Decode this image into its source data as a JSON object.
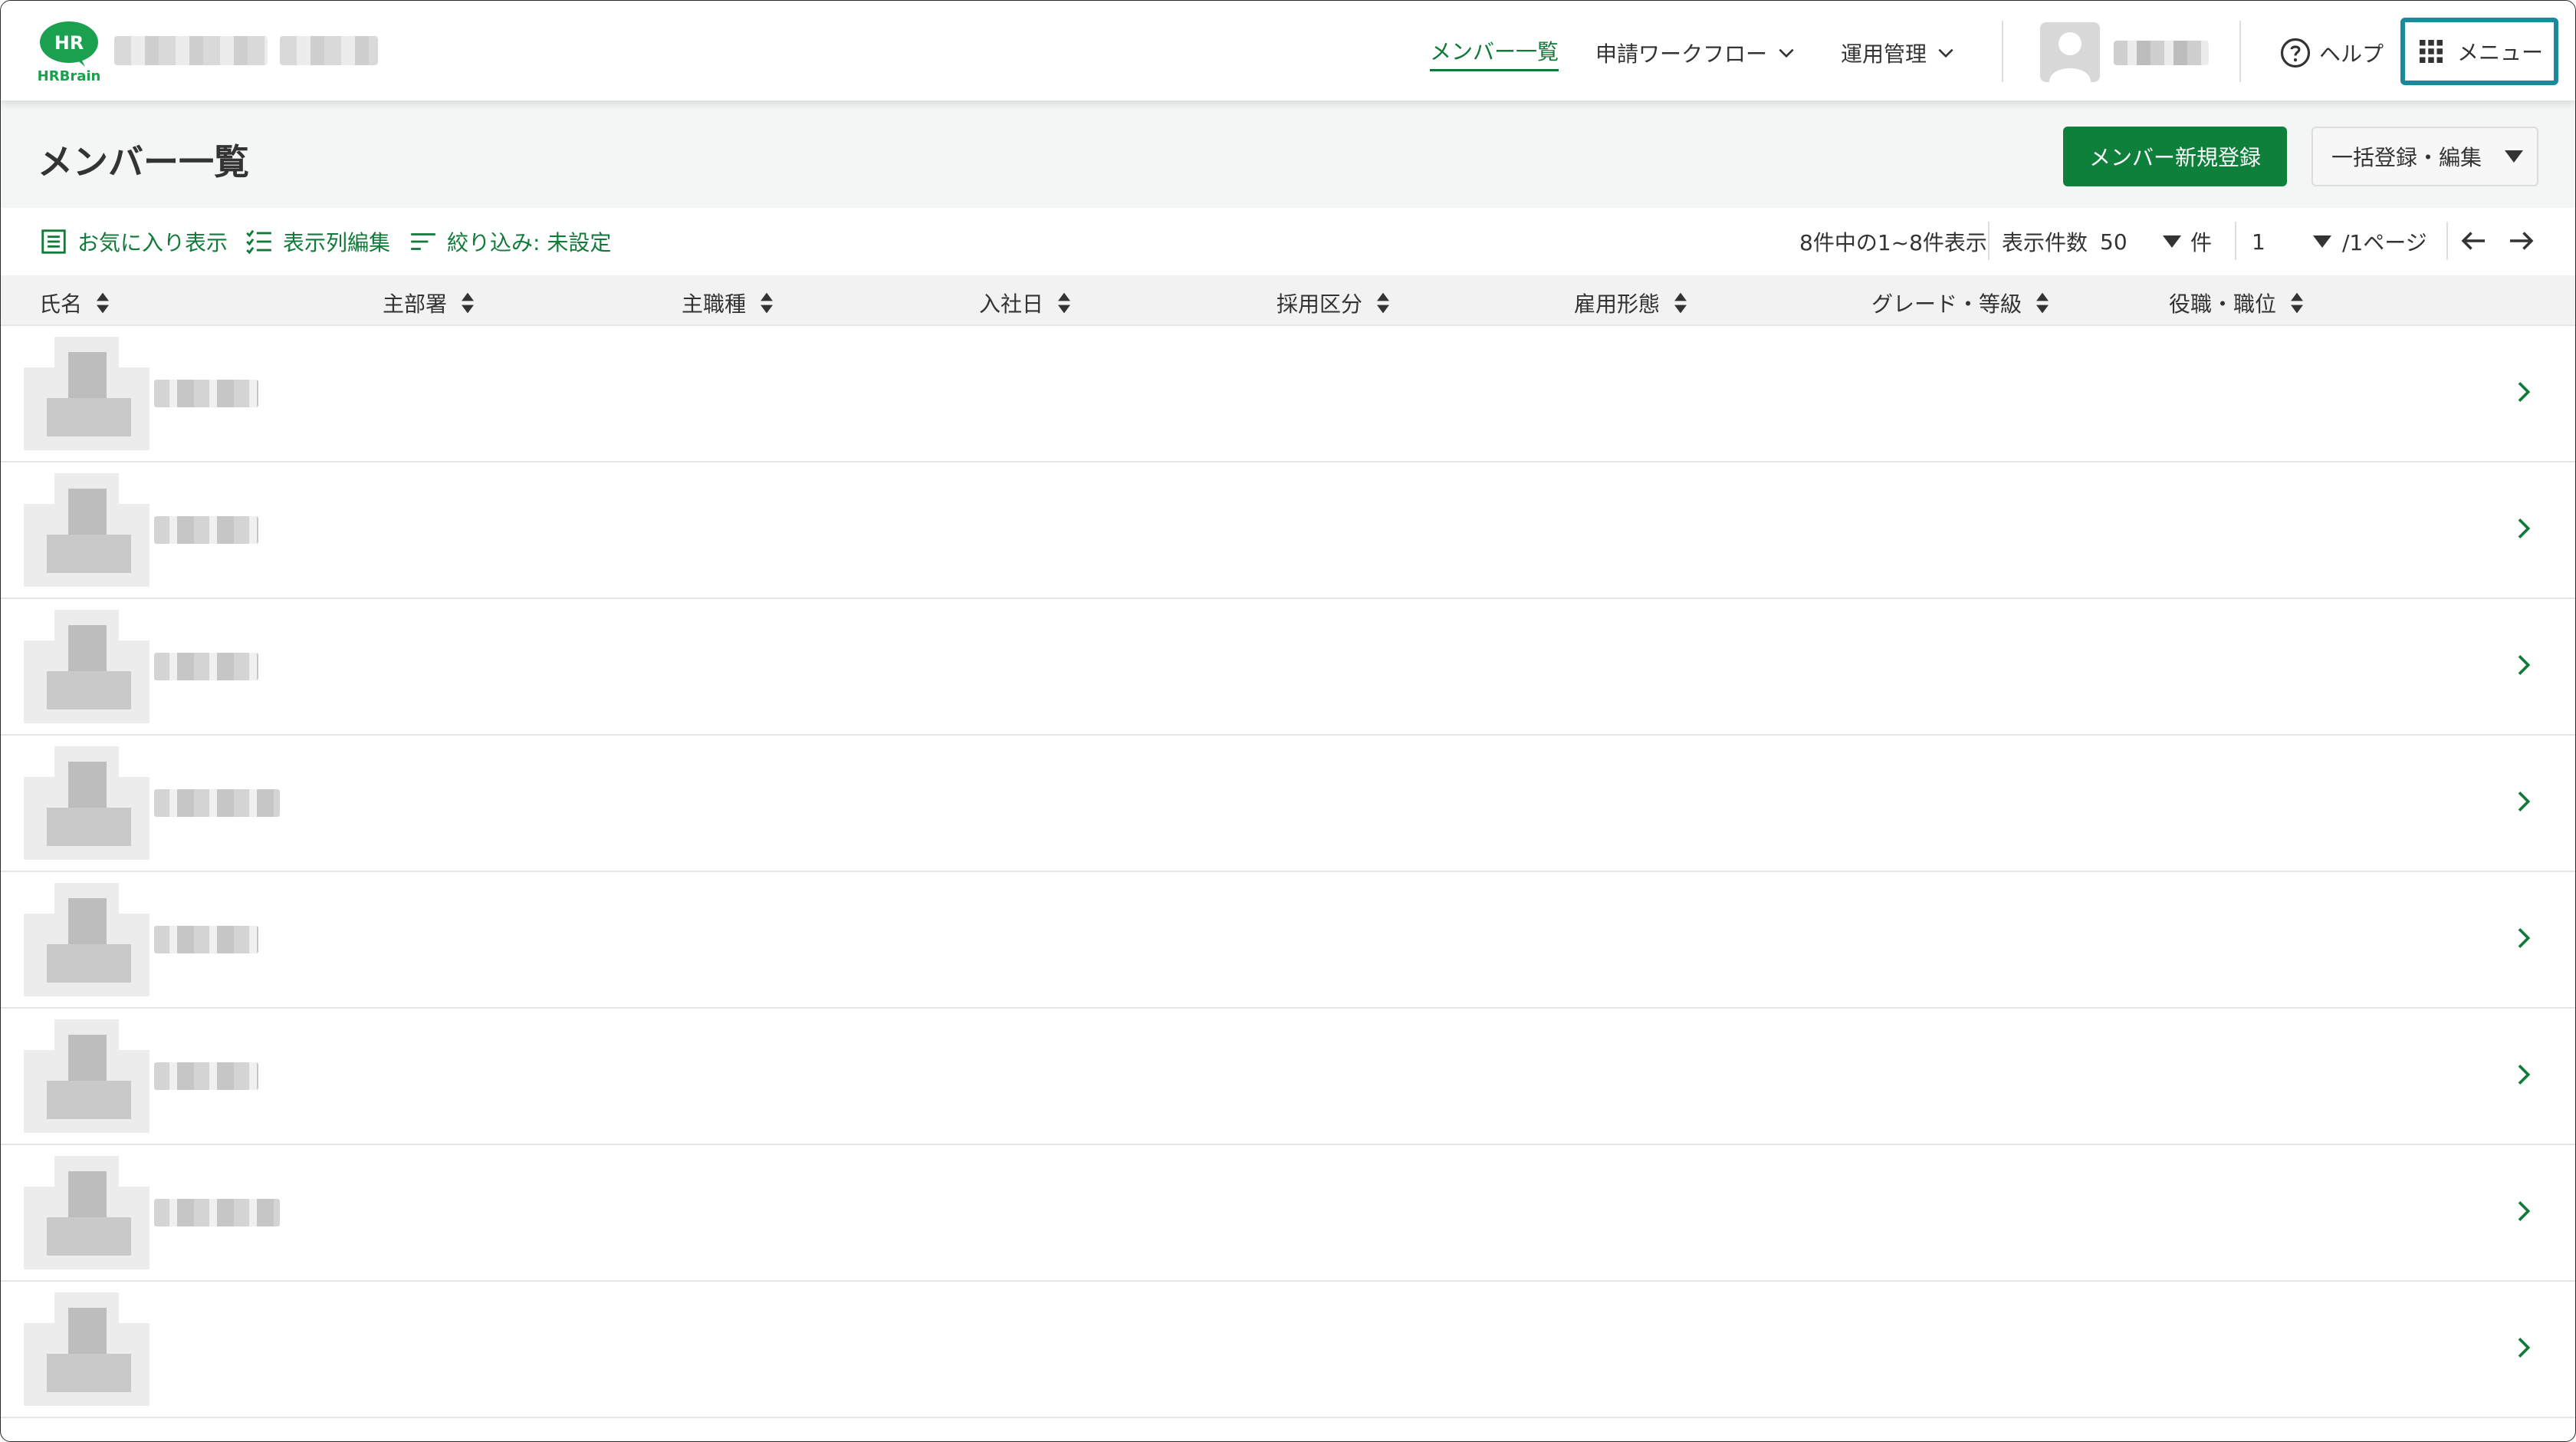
{
  "app": {
    "logo_text": "HR",
    "logo_caption": "HRBrain"
  },
  "nav": {
    "members": "メンバー一覧",
    "workflow": "申請ワークフロー",
    "operations": "運用管理",
    "help": "ヘルプ",
    "menu": "メニュー"
  },
  "page": {
    "title": "メンバー一覧",
    "new_member_button": "メンバー新規登録",
    "bulk_button": "一括登録・編集"
  },
  "toolbar": {
    "favorites": "お気に入り表示",
    "edit_columns": "表示列編集",
    "filter": "絞り込み: 未設定"
  },
  "pager": {
    "count_text": "8件中の1~8件表示",
    "size_label": "表示件数",
    "size_value": "50",
    "size_unit": "件",
    "page_value": "1",
    "page_total": "/1ページ"
  },
  "table": {
    "columns": [
      "氏名",
      "主部署",
      "主職種",
      "入社日",
      "採用区分",
      "雇用形態",
      "グレード・等級",
      "役職・職位"
    ],
    "row_count": 8
  },
  "colors": {
    "brand_green": "#0f7f3c",
    "menu_highlight": "#1a8a9a"
  }
}
